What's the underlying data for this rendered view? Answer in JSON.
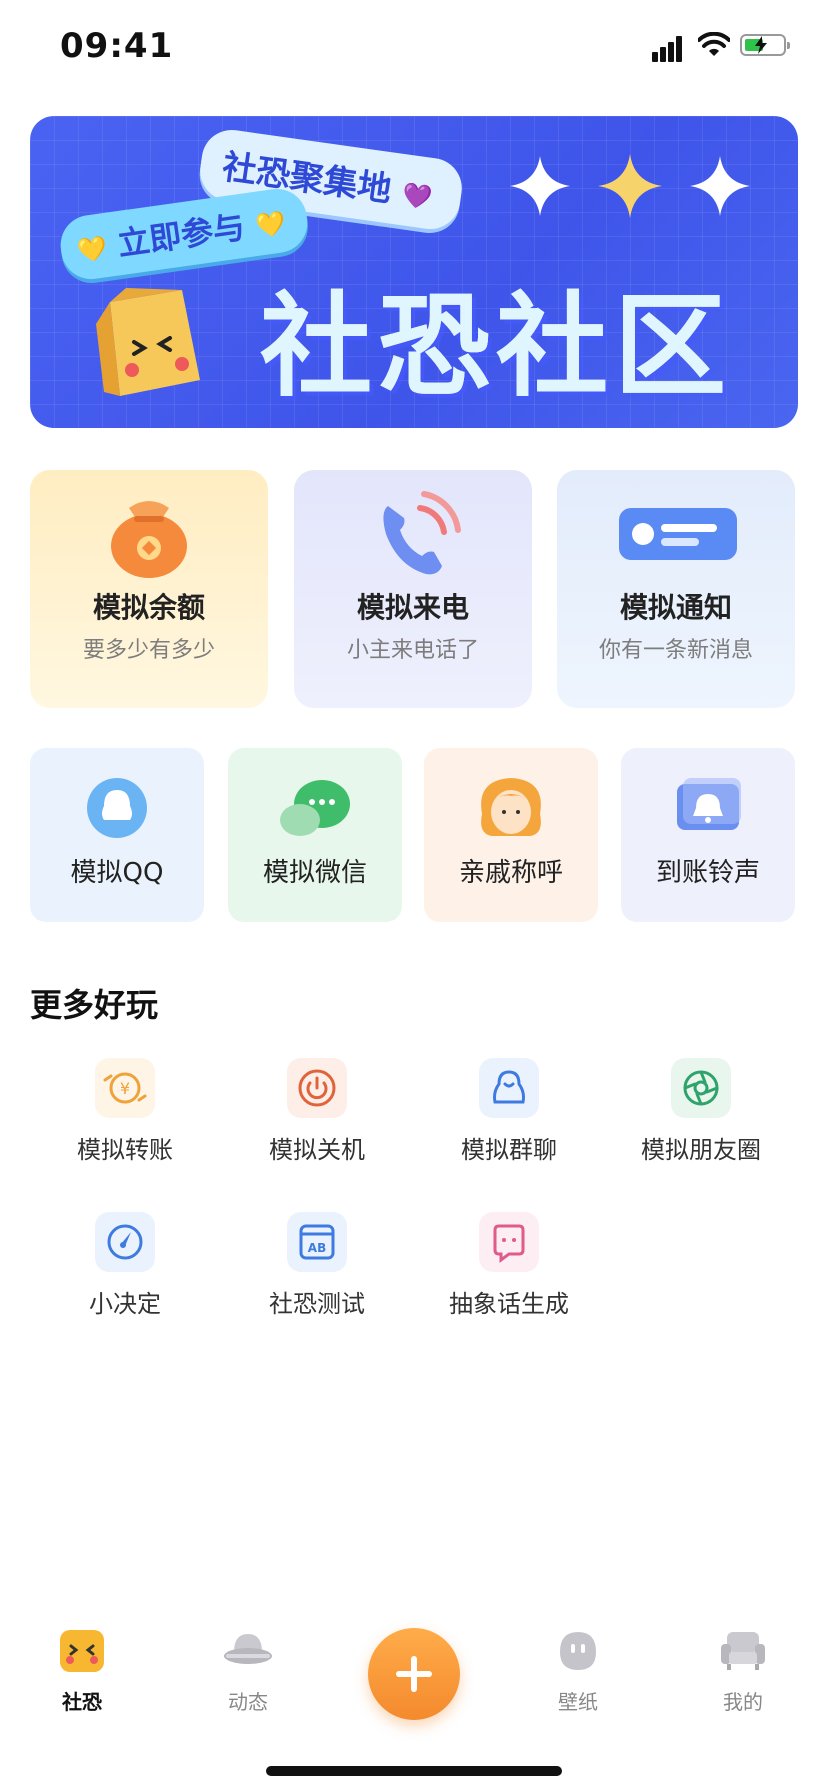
{
  "status_bar": {
    "time": "09:41"
  },
  "banner": {
    "bubble_top": "社恐聚集地",
    "bubble_left": "立即参与",
    "title": "社恐社区"
  },
  "feature_cards": [
    {
      "title": "模拟余额",
      "subtitle": "要多少有多少",
      "icon": "money-bag-icon"
    },
    {
      "title": "模拟来电",
      "subtitle": "小主来电话了",
      "icon": "phone-icon"
    },
    {
      "title": "模拟通知",
      "subtitle": "你有一条新消息",
      "icon": "notification-card-icon"
    }
  ],
  "quick_cards": [
    {
      "title": "模拟QQ",
      "icon": "qq-icon"
    },
    {
      "title": "模拟微信",
      "icon": "wechat-icon"
    },
    {
      "title": "亲戚称呼",
      "icon": "relative-face-icon"
    },
    {
      "title": "到账铃声",
      "icon": "bell-icon"
    }
  ],
  "more_section": {
    "title": "更多好玩",
    "items": [
      {
        "label": "模拟转账",
        "icon": "transfer-icon",
        "color": "#f0a23a"
      },
      {
        "label": "模拟关机",
        "icon": "power-icon",
        "color": "#e0643a"
      },
      {
        "label": "模拟群聊",
        "icon": "group-chat-icon",
        "color": "#3e7be0"
      },
      {
        "label": "模拟朋友圈",
        "icon": "moments-icon",
        "color": "#2fa36b"
      },
      {
        "label": "小决定",
        "icon": "compass-icon",
        "color": "#3e7be0"
      },
      {
        "label": "社恐测试",
        "icon": "ab-test-icon",
        "color": "#3e7be0"
      },
      {
        "label": "抽象话生成",
        "icon": "face-icon",
        "color": "#e05a8a"
      }
    ]
  },
  "tabbar": {
    "tabs": [
      {
        "label": "社恐",
        "icon": "mascot-icon",
        "active": true
      },
      {
        "label": "动态",
        "icon": "ufo-icon",
        "active": false
      },
      {
        "label": "壁纸",
        "icon": "ghost-icon",
        "active": false
      },
      {
        "label": "我的",
        "icon": "sofa-icon",
        "active": false
      }
    ],
    "fab_icon": "plus-icon"
  },
  "colors": {
    "banner_blue": "#3f55ea",
    "accent_orange": "#f48a2d"
  }
}
